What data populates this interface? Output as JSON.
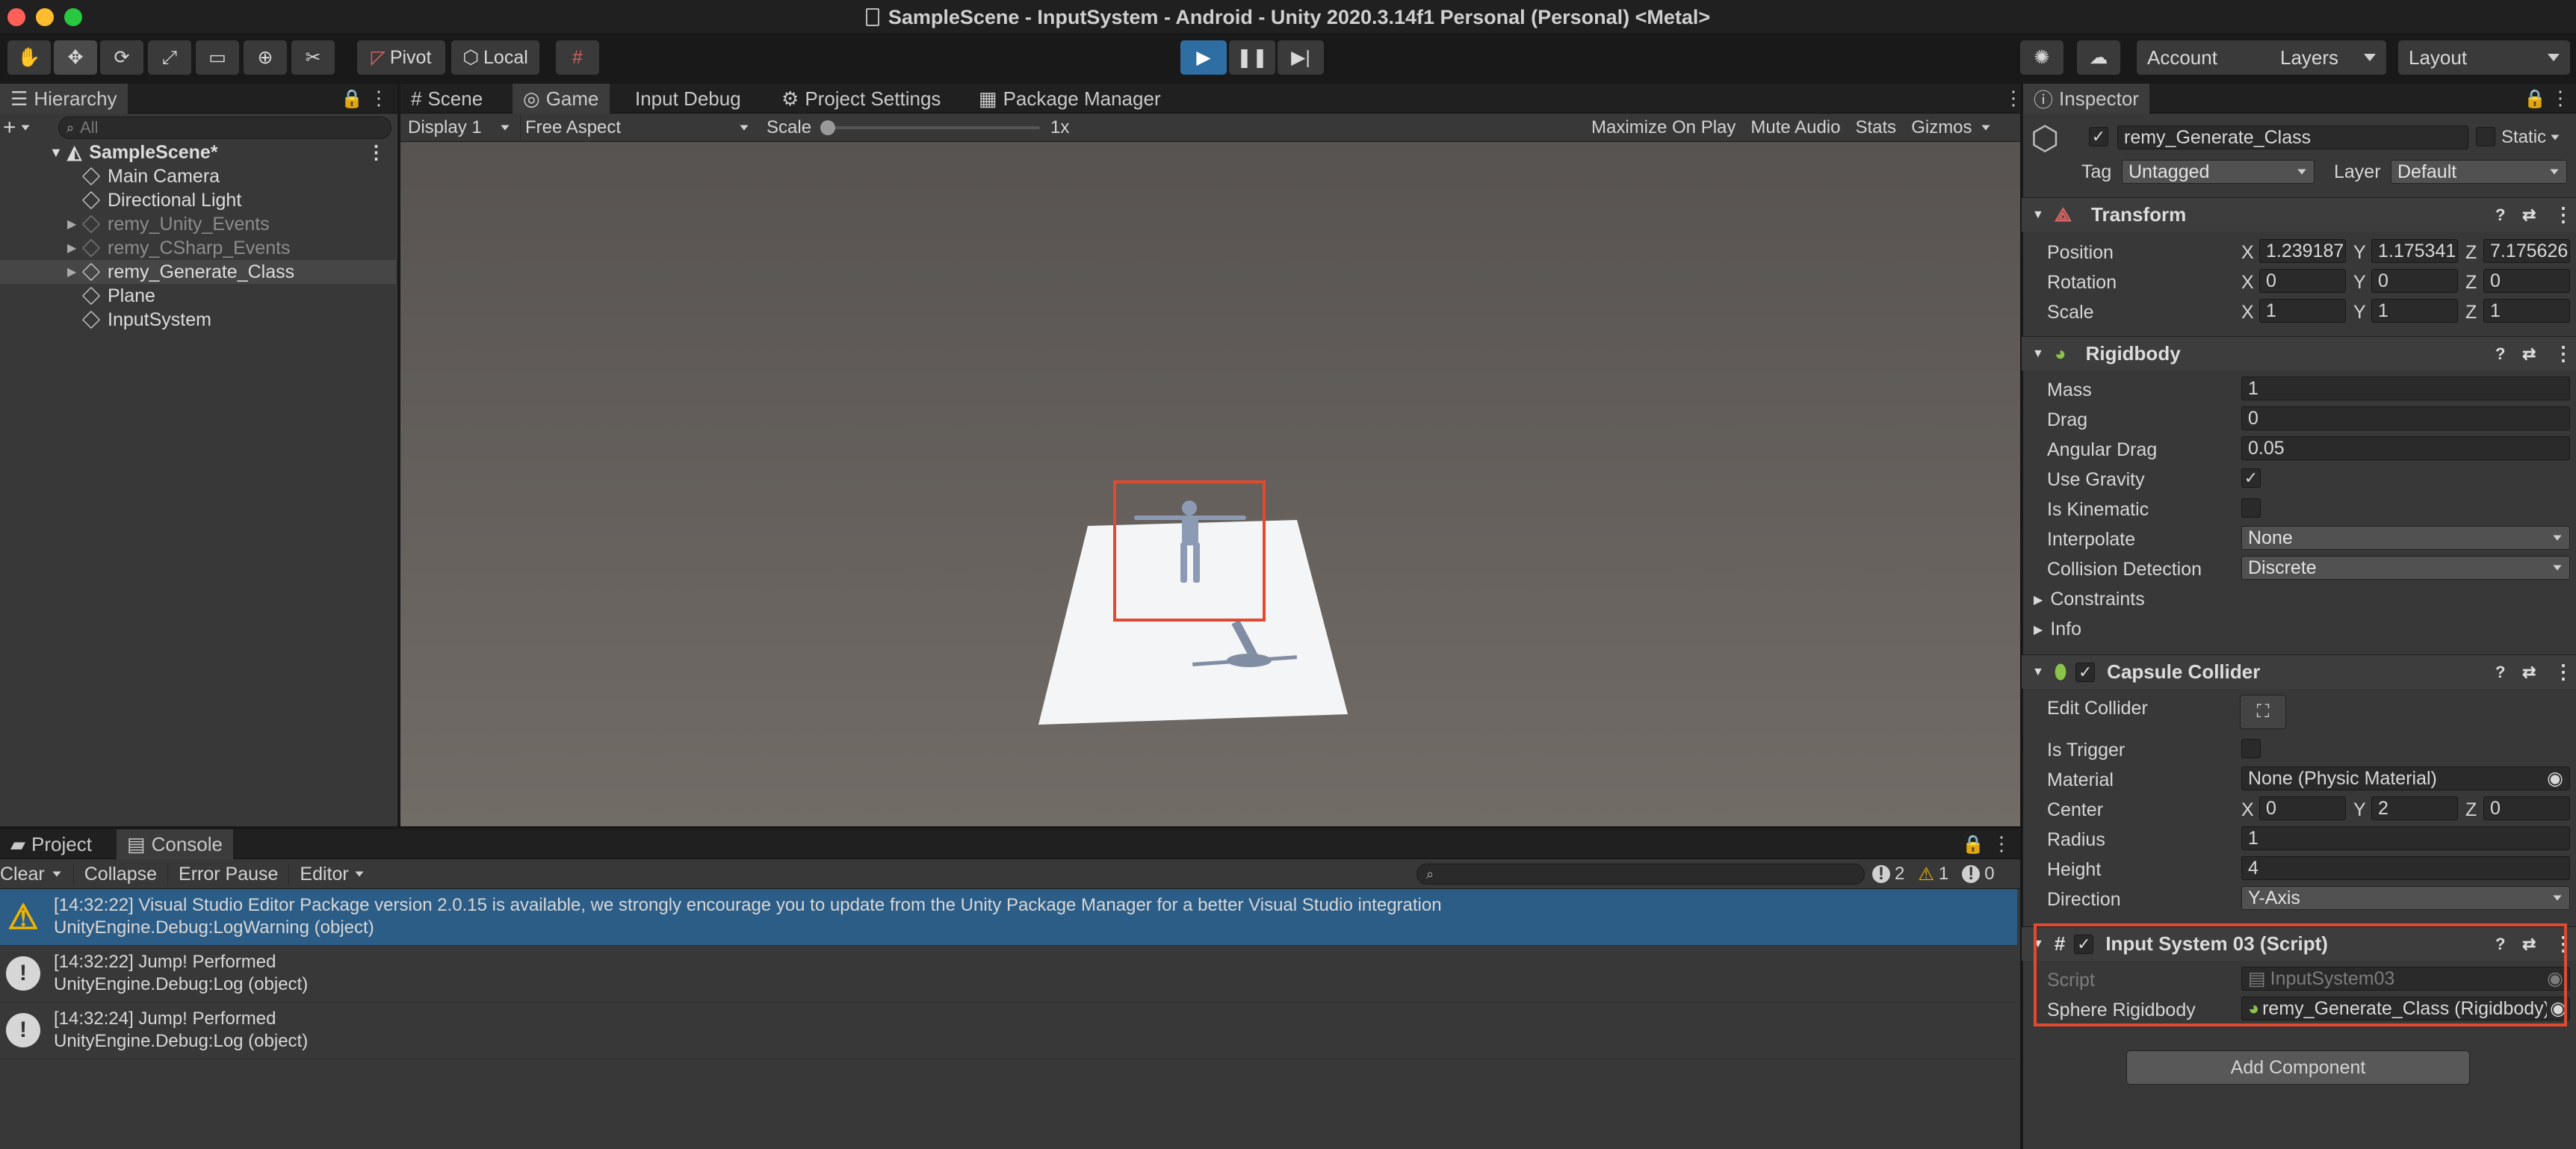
{
  "window": {
    "title": "SampleScene - InputSystem - Android - Unity 2020.3.14f1 Personal (Personal) <Metal>"
  },
  "colors": {
    "accent": "#2c5d87",
    "selection_box": "#e04a2f",
    "close": "#fe5f57",
    "min": "#febc2e",
    "max": "#28c840"
  },
  "toolbar": {
    "pivot": "Pivot",
    "local": "Local",
    "account": "Account",
    "layers": "Layers",
    "layout": "Layout"
  },
  "hierarchy": {
    "tab": "Hierarchy",
    "search_placeholder": "All",
    "scene": "SampleScene*",
    "items": [
      {
        "label": "Main Camera",
        "dim": false
      },
      {
        "label": "Directional Light",
        "dim": false
      },
      {
        "label": "remy_Unity_Events",
        "dim": true
      },
      {
        "label": "remy_CSharp_Events",
        "dim": true
      },
      {
        "label": "remy_Generate_Class",
        "dim": false
      },
      {
        "label": "Plane",
        "dim": false
      },
      {
        "label": "InputSystem",
        "dim": false
      }
    ]
  },
  "game": {
    "tabs": [
      "Scene",
      "Game",
      "Input Debug",
      "Project Settings",
      "Package Manager"
    ],
    "display": "Display 1",
    "aspect": "Free Aspect",
    "scale_label": "Scale",
    "scale_value": "1x",
    "maximize": "Maximize On Play",
    "mute": "Mute Audio",
    "stats": "Stats",
    "gizmos": "Gizmos"
  },
  "console": {
    "tabs": [
      "Project",
      "Console"
    ],
    "clear": "Clear",
    "collapse": "Collapse",
    "error_pause": "Error Pause",
    "editor": "Editor",
    "counts": {
      "log": "2",
      "warn": "1",
      "error": "0"
    },
    "entries": [
      {
        "type": "warning",
        "line1": "[14:32:22] Visual Studio Editor Package version 2.0.15 is available, we strongly encourage you to update from the Unity Package Manager for a better Visual Studio integration",
        "line2": "UnityEngine.Debug:LogWarning (object)"
      },
      {
        "type": "log",
        "line1": "[14:32:22] Jump! Performed",
        "line2": "UnityEngine.Debug:Log (object)"
      },
      {
        "type": "log",
        "line1": "[14:32:24] Jump! Performed",
        "line2": "UnityEngine.Debug:Log (object)"
      }
    ]
  },
  "inspector": {
    "tab": "Inspector",
    "object_name": "remy_Generate_Class",
    "static_label": "Static",
    "tag_label": "Tag",
    "tag_value": "Untagged",
    "layer_label": "Layer",
    "layer_value": "Default",
    "transform": {
      "title": "Transform",
      "position": {
        "label": "Position",
        "x": "1.239187",
        "y": "1.175341",
        "z": "7.175626"
      },
      "rotation": {
        "label": "Rotation",
        "x": "0",
        "y": "0",
        "z": "0"
      },
      "scale": {
        "label": "Scale",
        "x": "1",
        "y": "1",
        "z": "1"
      }
    },
    "rigidbody": {
      "title": "Rigidbody",
      "mass_label": "Mass",
      "mass": "1",
      "drag_label": "Drag",
      "drag": "0",
      "angular_label": "Angular Drag",
      "angular": "0.05",
      "gravity_label": "Use Gravity",
      "kinematic_label": "Is Kinematic",
      "interpolate_label": "Interpolate",
      "interpolate": "None",
      "collision_label": "Collision Detection",
      "collision": "Discrete",
      "constraints": "Constraints",
      "info": "Info"
    },
    "capsule": {
      "title": "Capsule Collider",
      "edit_label": "Edit Collider",
      "trigger_label": "Is Trigger",
      "material_label": "Material",
      "material": "None (Physic Material)",
      "center_label": "Center",
      "cx": "0",
      "cy": "2",
      "cz": "0",
      "radius_label": "Radius",
      "radius": "1",
      "height_label": "Height",
      "height": "4",
      "direction_label": "Direction",
      "direction": "Y-Axis"
    },
    "script": {
      "title": "Input System 03 (Script)",
      "script_label": "Script",
      "script_value": "InputSystem03",
      "sphere_label": "Sphere Rigidbody",
      "sphere_value": "remy_Generate_Class (Rigidbody)"
    },
    "add_component": "Add Component"
  },
  "axis_labels": {
    "x": "X",
    "y": "Y",
    "z": "Z"
  }
}
